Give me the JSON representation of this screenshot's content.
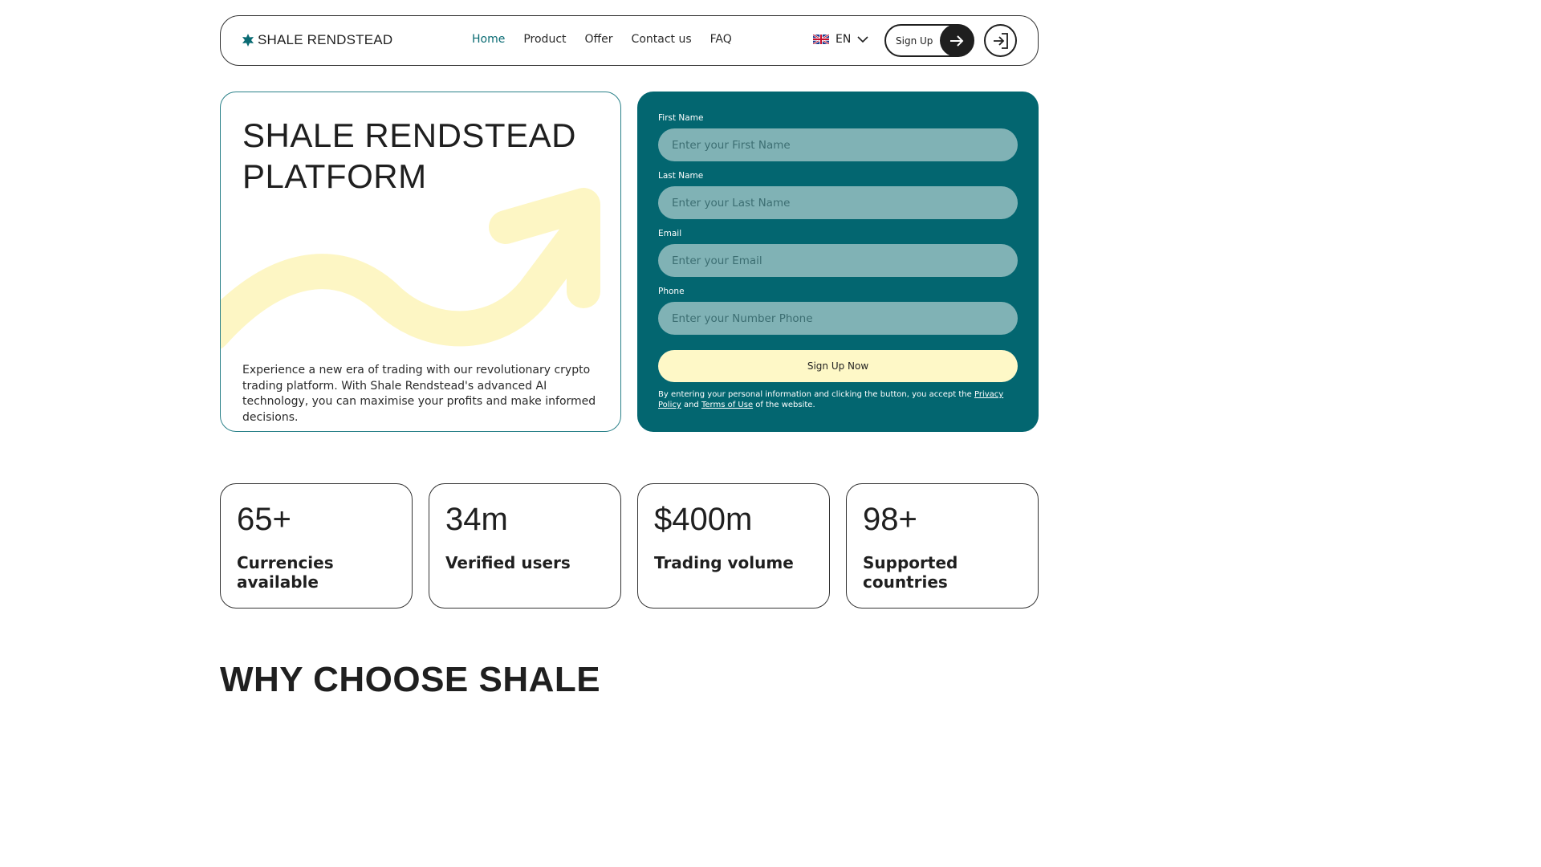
{
  "header": {
    "brand": "SHALE RENDSTEAD",
    "nav": [
      {
        "label": "Home",
        "active": true
      },
      {
        "label": "Product",
        "active": false
      },
      {
        "label": "Offer",
        "active": false
      },
      {
        "label": "Contact us",
        "active": false
      },
      {
        "label": "FAQ",
        "active": false
      }
    ],
    "language": "EN",
    "signup_label": "Sign Up",
    "icons": {
      "logo": "star-icon",
      "flag": "uk-flag-icon",
      "chevron": "chevron-down-icon",
      "signup": "arrow-right-icon",
      "login": "login-icon"
    }
  },
  "hero": {
    "title": "SHALE RENDSTEAD PLATFORM",
    "description": "Experience a new era of trading with our revolutionary crypto trading platform. With Shale Rendstead's advanced AI technology, you can maximise your profits and make informed decisions."
  },
  "form": {
    "fields": [
      {
        "label": "First Name",
        "placeholder": "Enter your First Name"
      },
      {
        "label": "Last Name",
        "placeholder": "Enter your Last Name"
      },
      {
        "label": "Email",
        "placeholder": "Enter your Email"
      },
      {
        "label": "Phone",
        "placeholder": "Enter your Number Phone"
      }
    ],
    "submit_label": "Sign Up Now",
    "disclaimer_prefix": "By entering your personal information and clicking the button, you accept the",
    "privacy_link": "Privacy Policy",
    "disclaimer_and": "and",
    "terms_link": "Terms of Use",
    "disclaimer_suffix": "of the website."
  },
  "stats": [
    {
      "value": "65+",
      "label": "Currencies available"
    },
    {
      "value": "34m",
      "label": "Verified users"
    },
    {
      "value": "$400m",
      "label": "Trading volume"
    },
    {
      "value": "98+",
      "label": "Supported countries"
    }
  ],
  "section": {
    "title": "WHY CHOOSE SHALE"
  },
  "colors": {
    "brand_teal": "#036670",
    "accent_yellow": "#fef8c7",
    "active_link": "#0a6b73"
  }
}
